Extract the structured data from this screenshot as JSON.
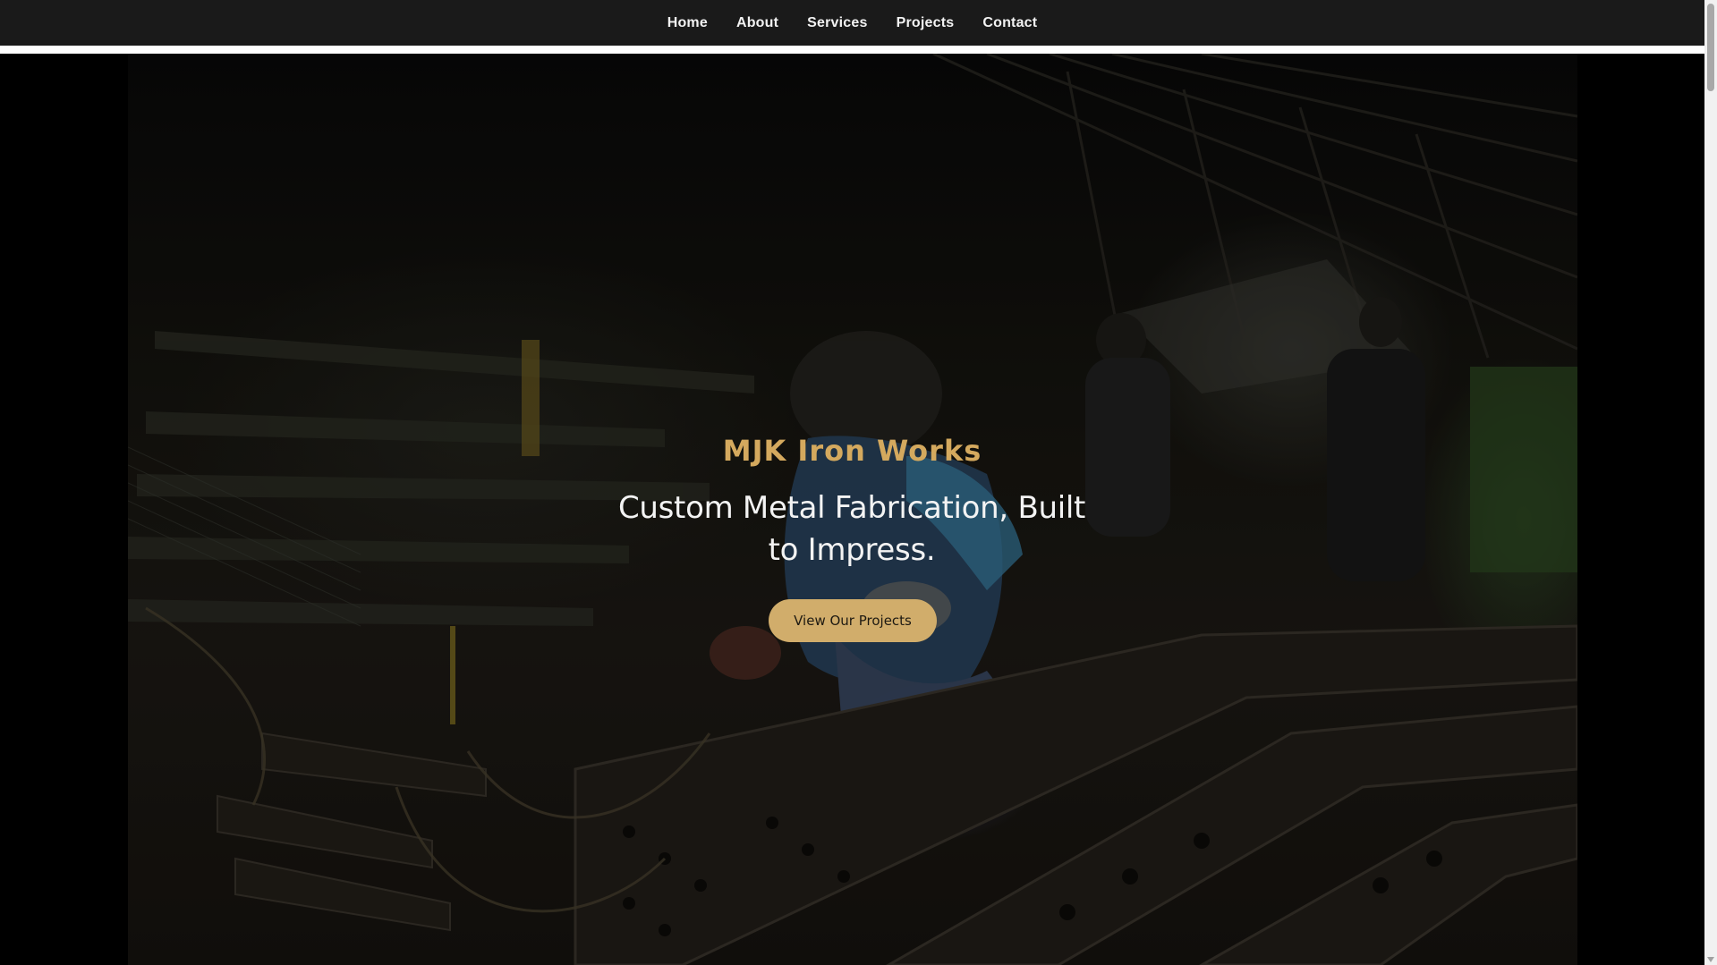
{
  "nav": {
    "items": [
      {
        "label": "Home"
      },
      {
        "label": "About"
      },
      {
        "label": "Services"
      },
      {
        "label": "Projects"
      },
      {
        "label": "Contact"
      }
    ]
  },
  "hero": {
    "title": "MJK Iron Works",
    "tagline": "Custom Metal Fabrication, Built to Impress.",
    "cta_label": "View Our Projects",
    "background_image": "welder-in-metal-workshop",
    "accent_color": "#d4a95e",
    "button_color": "#d1ad6b"
  },
  "colors": {
    "nav_bg": "#1a1a1a",
    "nav_text": "#f2f2f2",
    "hero_bg": "#000000"
  }
}
